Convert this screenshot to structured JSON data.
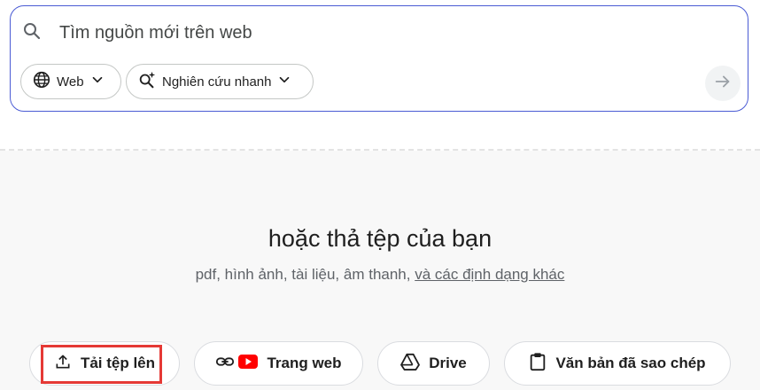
{
  "search": {
    "placeholder": "Tìm nguồn mới trên web",
    "chips": {
      "web_label": "Web",
      "research_label": "Nghiên cứu nhanh"
    },
    "submit_icon": "arrow-right-icon"
  },
  "drop_zone": {
    "title": "hoặc thả tệp của bạn",
    "subtitle": "pdf, hình ảnh, tài liệu, âm thanh,",
    "more_formats_link": "và các định dạng khác"
  },
  "source_buttons": {
    "upload": "Tải tệp lên",
    "website": "Trang web",
    "drive": "Drive",
    "copied_text": "Văn bản đã sao chép"
  },
  "colors": {
    "search_border": "#4a5bd4",
    "highlight": "#e53935",
    "youtube_red": "#ff0000",
    "drop_background": "#f8f8f8"
  }
}
